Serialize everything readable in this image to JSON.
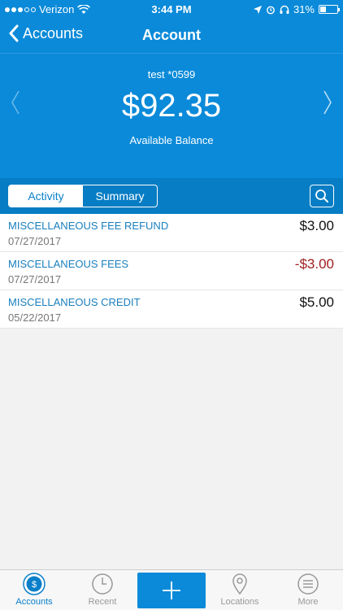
{
  "statusbar": {
    "carrier": "Verizon",
    "time": "3:44 PM",
    "battery": "31%"
  },
  "navbar": {
    "back_label": "Accounts",
    "title": "Account"
  },
  "account": {
    "name": "test *0599",
    "balance": "$92.35",
    "balance_label": "Available Balance"
  },
  "tabs": {
    "activity": "Activity",
    "summary": "Summary"
  },
  "transactions": [
    {
      "name": "MISCELLANEOUS FEE REFUND",
      "date": "07/27/2017",
      "amount": "$3.00"
    },
    {
      "name": "MISCELLANEOUS FEES",
      "date": "07/27/2017",
      "amount": "-$3.00"
    },
    {
      "name": "MISCELLANEOUS CREDIT",
      "date": "05/22/2017",
      "amount": "$5.00"
    }
  ],
  "tabbar": {
    "accounts": "Accounts",
    "recent": "Recent",
    "locations": "Locations",
    "more": "More"
  },
  "colors": {
    "brand": "#0a8ad9",
    "link": "#1a7fbf",
    "negative": "#a02020"
  }
}
